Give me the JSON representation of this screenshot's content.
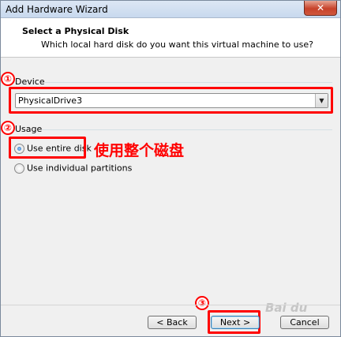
{
  "window": {
    "title": "Add Hardware Wizard",
    "close_glyph": "✕"
  },
  "header": {
    "title": "Select a Physical Disk",
    "subtitle": "Which local hard disk do you want this virtual machine to use?"
  },
  "device": {
    "label": "Device",
    "selected": "PhysicalDrive3"
  },
  "usage": {
    "label": "Usage",
    "options": [
      {
        "label": "Use entire disk",
        "selected": true
      },
      {
        "label": "Use individual partitions",
        "selected": false
      }
    ]
  },
  "annotations": {
    "markers": [
      "①",
      "②",
      "③"
    ],
    "chinese_note": "使用整个磁盘",
    "accent_color": "#ff0000"
  },
  "buttons": {
    "back": "< Back",
    "next": "Next >",
    "cancel": "Cancel"
  },
  "watermark": "Bai du"
}
